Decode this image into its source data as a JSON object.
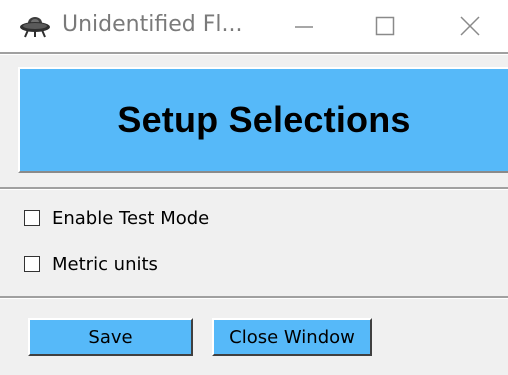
{
  "window": {
    "title": "Unidentified Fl...",
    "minimize_glyph": "—",
    "maximize_glyph": "☐",
    "close_glyph": "✕",
    "app_icon": "ufo-icon"
  },
  "banner": {
    "title": "Setup Selections",
    "color": "#56b9f9"
  },
  "options": [
    {
      "label": "Enable Test Mode",
      "checked": false
    },
    {
      "label": "Metric units",
      "checked": false
    }
  ],
  "buttons": {
    "save_label": "Save",
    "close_label": "Close Window",
    "color": "#56b9f9"
  }
}
